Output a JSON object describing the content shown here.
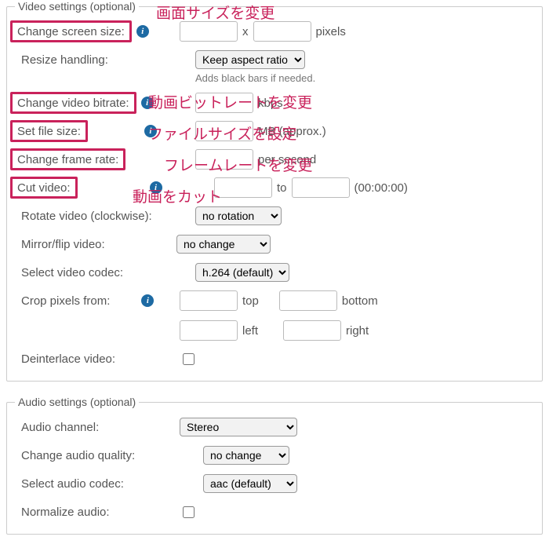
{
  "video_section": {
    "legend": "Video settings (optional)",
    "screen_size": {
      "label": "Change screen size:",
      "annot": "画面サイズを変更",
      "sep": "x",
      "unit": "pixels"
    },
    "resize_handling": {
      "label": "Resize handling:",
      "select": "Keep aspect ratio",
      "hint": "Adds black bars if needed."
    },
    "bitrate": {
      "label": "Change video bitrate:",
      "annot": "動画ビットレートを変更",
      "unit": "kbps"
    },
    "file_size": {
      "label": "Set file size:",
      "annot": "ファイルサイズを設定",
      "unit": "MB (approx.)"
    },
    "frame_rate": {
      "label": "Change frame rate:",
      "annot": "フレームレートを変更",
      "unit": "per second"
    },
    "cut": {
      "label": "Cut video:",
      "annot": "動画をカット",
      "sep": "to",
      "hint": "(00:00:00)"
    },
    "rotate": {
      "label": "Rotate video (clockwise):",
      "select": "no rotation"
    },
    "mirror": {
      "label": "Mirror/flip video:",
      "select": "no change"
    },
    "codec": {
      "label": "Select video codec:",
      "select": "h.264 (default)"
    },
    "crop": {
      "label": "Crop pixels from:",
      "top": "top",
      "bottom": "bottom",
      "left": "left",
      "right": "right"
    },
    "deinterlace": {
      "label": "Deinterlace video:"
    }
  },
  "audio_section": {
    "legend": "Audio settings (optional)",
    "channel": {
      "label": "Audio channel:",
      "select": "Stereo"
    },
    "quality": {
      "label": "Change audio quality:",
      "select": "no change"
    },
    "codec": {
      "label": "Select audio codec:",
      "select": "aac (default)"
    },
    "normalize": {
      "label": "Normalize audio:"
    }
  },
  "colors": {
    "accent": "#c9225b"
  }
}
